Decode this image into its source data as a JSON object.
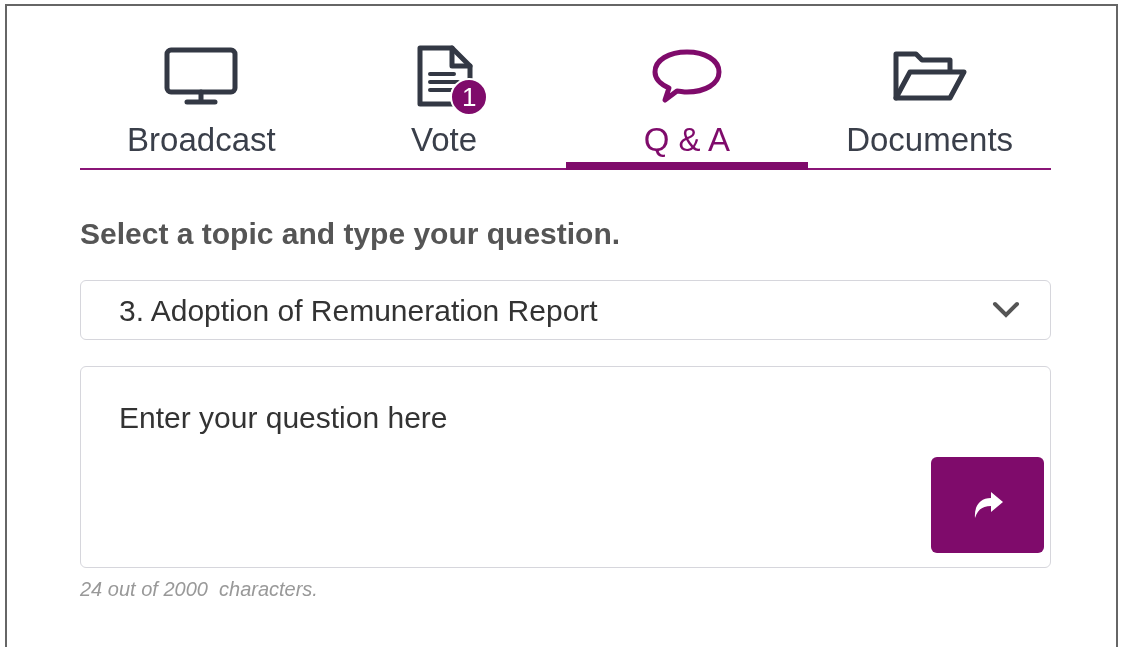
{
  "tabs": [
    {
      "kind": "monitor",
      "label": "Broadcast",
      "selected": false
    },
    {
      "kind": "document",
      "label": "Vote",
      "selected": false,
      "badge": "1"
    },
    {
      "kind": "chat",
      "label": "Q & A",
      "selected": true
    },
    {
      "kind": "folder",
      "label": "Documents",
      "selected": false
    }
  ],
  "heading": "Select a topic and type your question.",
  "topic_select": {
    "value": "3. Adoption of Remuneration Report"
  },
  "question": {
    "value": "Enter your question here"
  },
  "counter": "24 out of 2000  characters."
}
